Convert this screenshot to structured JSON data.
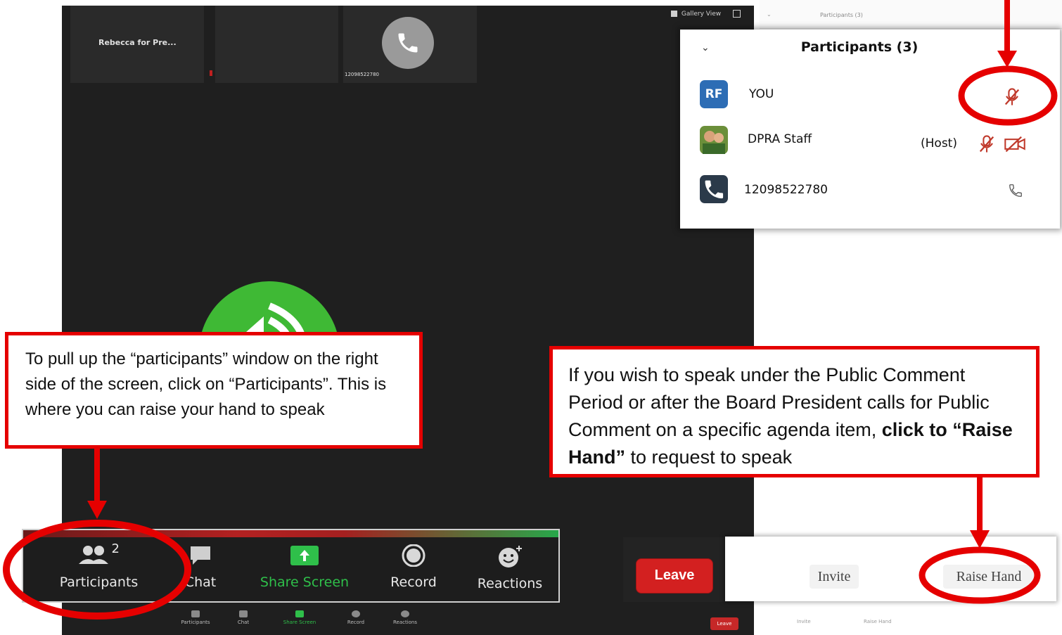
{
  "meeting": {
    "tile1_name": "Rebecca for Pre...",
    "tile3_number": "12098522780",
    "top_controls": {
      "gallery_view": "Gallery View"
    }
  },
  "sidebar": {
    "header_title": "Participants (3)",
    "footer_invite": "Invite",
    "footer_raise": "Raise Hand"
  },
  "participants_panel": {
    "title": "Participants (3)",
    "rows": [
      {
        "initials": "RF",
        "name": "YOU",
        "role": "",
        "avatar_color": "#2d6db5"
      },
      {
        "initials": "",
        "name": "DPRA Staff",
        "role": "(Host)",
        "avatar_color": "#6b8f3a"
      },
      {
        "initials": "",
        "name": "12098522780",
        "role": "",
        "avatar_color": "#2b3a4a"
      }
    ]
  },
  "toolbar": {
    "participants_label": "Participants",
    "participants_count": "2",
    "chat_label": "Chat",
    "share_label": "Share Screen",
    "record_label": "Record",
    "reactions_label": "Reactions",
    "share_color": "#2fbf4a"
  },
  "mini_toolbar": {
    "participants": "Participants",
    "chat": "Chat",
    "share": "Share Screen",
    "record": "Record",
    "reactions": "Reactions",
    "leave": "Leave"
  },
  "leave_button": "Leave",
  "invite_button": "Invite",
  "raise_hand_button": "Raise Hand",
  "callouts": {
    "left": "To pull up the “participants” window on the right side of the screen, click on “Participants”. This is where you can raise your hand to speak",
    "right_prefix": "If you wish to speak under the Public Comment Period or after the Board President calls for Public Comment on a specific agenda item, ",
    "right_bold": "click to “Raise Hand”",
    "right_suffix": " to request to speak"
  },
  "colors": {
    "annotation_red": "#e50000",
    "zoom_green": "#3fb935"
  }
}
